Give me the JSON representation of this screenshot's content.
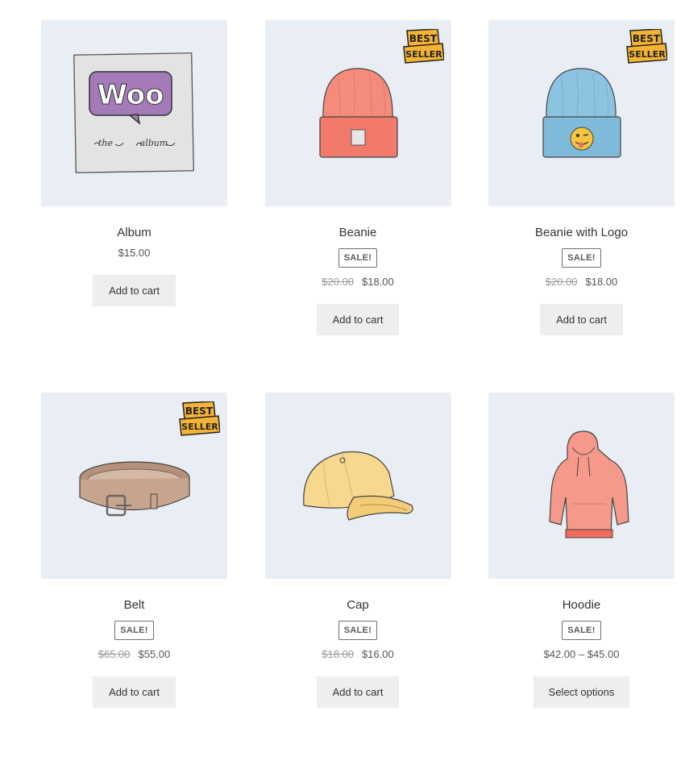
{
  "products": [
    {
      "name": "Album",
      "price": "$15.00",
      "button": "Add to cart",
      "best_seller": false,
      "on_sale": false,
      "image": "album-cover"
    },
    {
      "name": "Beanie",
      "sale_badge": "SALE!",
      "old_price": "$20.00",
      "new_price": "$18.00",
      "button": "Add to cart",
      "best_seller": true,
      "on_sale": true,
      "image": "beanie"
    },
    {
      "name": "Beanie with Logo",
      "sale_badge": "SALE!",
      "old_price": "$20.00",
      "new_price": "$18.00",
      "button": "Add to cart",
      "best_seller": true,
      "on_sale": true,
      "image": "beanie-with-logo"
    },
    {
      "name": "Belt",
      "sale_badge": "SALE!",
      "old_price": "$65.00",
      "new_price": "$55.00",
      "button": "Add to cart",
      "best_seller": true,
      "on_sale": true,
      "image": "belt"
    },
    {
      "name": "Cap",
      "sale_badge": "SALE!",
      "old_price": "$18.00",
      "new_price": "$16.00",
      "button": "Add to cart",
      "best_seller": false,
      "on_sale": true,
      "image": "cap"
    },
    {
      "name": "Hoodie",
      "sale_badge": "SALE!",
      "price_range": "$42.00 – $45.00",
      "button": "Select options",
      "best_seller": false,
      "on_sale": true,
      "image": "hoodie"
    }
  ],
  "best_seller_badge": {
    "line1": "BEST",
    "line2": "SELLER",
    "color": "#f5b335"
  },
  "album_art": {
    "logo_text": "Woo",
    "caption_left": "the",
    "caption_right": "album",
    "logo_color": "#a47ab8"
  },
  "colors": {
    "thumb_bg": "#e8eef4",
    "button_bg": "#eeeeee"
  }
}
